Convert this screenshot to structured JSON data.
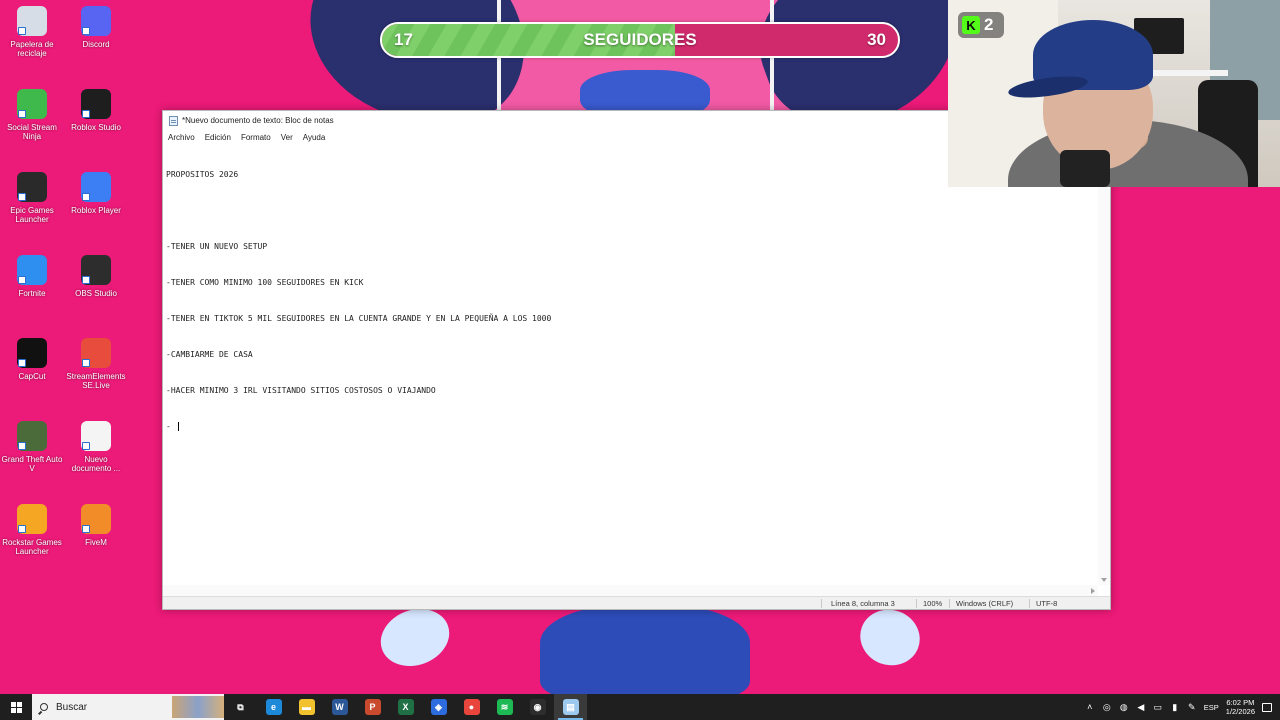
{
  "desktop": {
    "icons": [
      {
        "label": "Papelera de reciclaje",
        "icon": "recycle-bin-icon",
        "color": "#d7dde6"
      },
      {
        "label": "Discord",
        "icon": "discord-icon",
        "color": "#5865f2"
      },
      {
        "label": "Social Stream Ninja",
        "icon": "social-stream-ninja-icon",
        "color": "#3fb94b"
      },
      {
        "label": "Roblox Studio",
        "icon": "roblox-studio-icon",
        "color": "#1e1e1e"
      },
      {
        "label": "Epic Games Launcher",
        "icon": "epic-games-icon",
        "color": "#2a2a2a"
      },
      {
        "label": "Roblox Player",
        "icon": "roblox-player-icon",
        "color": "#3c7ff5"
      },
      {
        "label": "Fortnite",
        "icon": "fortnite-icon",
        "color": "#2f8ff0"
      },
      {
        "label": "OBS Studio",
        "icon": "obs-icon",
        "color": "#2d2d2d"
      },
      {
        "label": "CapCut",
        "icon": "capcut-icon",
        "color": "#111111"
      },
      {
        "label": "StreamElements SE.Live",
        "icon": "streamelements-icon",
        "color": "#e74c3c"
      },
      {
        "label": "Grand Theft Auto V",
        "icon": "gta-v-icon",
        "color": "#4b6b3a"
      },
      {
        "label": "Nuevo documento ...",
        "icon": "text-document-icon",
        "color": "#f4f4f4"
      },
      {
        "label": "Rockstar Games Launcher",
        "icon": "rockstar-icon",
        "color": "#f5a623"
      },
      {
        "label": "FiveM",
        "icon": "fivem-icon",
        "color": "#f28c28"
      }
    ]
  },
  "follower_goal": {
    "current": "17",
    "label": "SEGUIDORES",
    "goal": "30",
    "progress": 0.567
  },
  "notepad": {
    "title": "*Nuevo documento de texto: Bloc de notas",
    "menu": [
      "Archivo",
      "Edición",
      "Formato",
      "Ver",
      "Ayuda"
    ],
    "lines": [
      "PROPOSITOS 2026",
      "",
      "-TENER UN NUEVO SETUP",
      "-TENER COMO MINIMO 100 SEGUIDORES EN KICK",
      "-TENER EN TIKTOK 5 MIL SEGUIDORES EN LA CUENTA GRANDE Y EN LA PEQUEÑA A LOS 1000",
      "-CAMBIARME DE CASA",
      "-HACER MINIMO 3 IRL VISITANDO SITIOS COSTOSOS O VIAJANDO",
      "- "
    ],
    "status": {
      "position": "Línea 8, columna 3",
      "zoom": "100%",
      "line_endings": "Windows (CRLF)",
      "encoding": "UTF-8"
    }
  },
  "webcam": {
    "kick_count": "2",
    "kick_letter": "K",
    "kick_color": "#53fc18"
  },
  "taskbar": {
    "search_placeholder": "Buscar",
    "apps": [
      {
        "name": "task-view-icon",
        "glyph": "⧉",
        "color": "#1f1f1f"
      },
      {
        "name": "edge-icon",
        "glyph": "e",
        "color": "#1c8ad8"
      },
      {
        "name": "file-explorer-icon",
        "glyph": "▬",
        "color": "#f2c12e"
      },
      {
        "name": "word-icon",
        "glyph": "W",
        "color": "#2b5797"
      },
      {
        "name": "powerpoint-icon",
        "glyph": "P",
        "color": "#c94a2c"
      },
      {
        "name": "excel-icon",
        "glyph": "X",
        "color": "#1f7145"
      },
      {
        "name": "app-icon",
        "glyph": "◈",
        "color": "#2d6cdf"
      },
      {
        "name": "chrome-icon",
        "glyph": "●",
        "color": "#e8453c"
      },
      {
        "name": "spotify-icon",
        "glyph": "≋",
        "color": "#1db954"
      },
      {
        "name": "obs-taskbar-icon",
        "glyph": "◉",
        "color": "#2d2d2d"
      },
      {
        "name": "notepad-taskbar-icon",
        "glyph": "▤",
        "color": "#9ec9ee"
      }
    ],
    "tray": {
      "language": "ESP",
      "time": "6:02 PM",
      "date": "1/2/2026"
    }
  }
}
